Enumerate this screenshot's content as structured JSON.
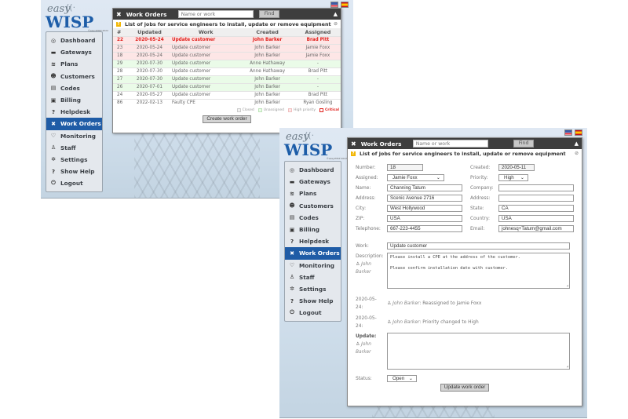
{
  "app": {
    "logo_top": "easy",
    "logo_main": "WISP",
    "logo_copyright": "©easyWISP 2022",
    "flags": [
      "English",
      "Español"
    ]
  },
  "sidebar": {
    "items": [
      {
        "label": "Dashboard",
        "icon": "dashboard-icon",
        "glyph": "◎"
      },
      {
        "label": "Gateways",
        "icon": "gateway-icon",
        "glyph": "▬"
      },
      {
        "label": "Plans",
        "icon": "plans-icon",
        "glyph": "≋"
      },
      {
        "label": "Customers",
        "icon": "customers-icon",
        "glyph": "☻"
      },
      {
        "label": "Codes",
        "icon": "codes-icon",
        "glyph": "▤"
      },
      {
        "label": "Billing",
        "icon": "billing-icon",
        "glyph": "▣"
      },
      {
        "label": "Helpdesk",
        "icon": "helpdesk-icon",
        "glyph": "?"
      },
      {
        "label": "Work Orders",
        "icon": "tools-icon",
        "glyph": "✖",
        "active": true
      },
      {
        "label": "Monitoring",
        "icon": "heartbeat-icon",
        "glyph": "♡"
      },
      {
        "label": "Staff",
        "icon": "user-icon",
        "glyph": "♙"
      },
      {
        "label": "Settings",
        "icon": "gear-icon",
        "glyph": "✲"
      },
      {
        "label": "Show Help",
        "icon": "help-icon",
        "glyph": "?"
      },
      {
        "label": "Logout",
        "icon": "power-icon",
        "glyph": "⏻"
      }
    ]
  },
  "panel": {
    "title": "Work Orders",
    "search_placeholder": "Name or work",
    "find_label": "Find",
    "info": "List of jobs for service engineers to install, update or remove equipment"
  },
  "list": {
    "columns": [
      "#",
      "Updated",
      "Work",
      "Created",
      "Assigned"
    ],
    "rows": [
      {
        "num": "22",
        "updated": "2020-05-24",
        "work": "Update customer",
        "created": "John Barker",
        "assigned": "Brad Pitt",
        "type": "crit"
      },
      {
        "num": "23",
        "updated": "2020-05-24",
        "work": "Update customer",
        "created": "John Barker",
        "assigned": "Jamie Foxx",
        "type": "pink"
      },
      {
        "num": "18",
        "updated": "2020-05-24",
        "work": "Update customer",
        "created": "John Barker",
        "assigned": "Jamie Foxx",
        "type": "pink"
      },
      {
        "num": "29",
        "updated": "2020-07-30",
        "work": "Update customer",
        "created": "Anne Hathaway",
        "assigned": "-",
        "type": "green"
      },
      {
        "num": "28",
        "updated": "2020-07-30",
        "work": "Update customer",
        "created": "Anne Hathaway",
        "assigned": "Brad Pitt",
        "type": "white"
      },
      {
        "num": "27",
        "updated": "2020-07-30",
        "work": "Update customer",
        "created": "John Barker",
        "assigned": "-",
        "type": "green"
      },
      {
        "num": "26",
        "updated": "2020-07-01",
        "work": "Update customer",
        "created": "John Barker",
        "assigned": "-",
        "type": "green"
      },
      {
        "num": "24",
        "updated": "2020-05-27",
        "work": "Update customer",
        "created": "John Barker",
        "assigned": "Brad Pitt",
        "type": "white"
      },
      {
        "num": "86",
        "updated": "2022-02-13",
        "work": "Faulty CPE",
        "created": "John Barker",
        "assigned": "Ryan Gosling",
        "type": "white"
      }
    ],
    "legend": [
      "Closed",
      "Unassigned",
      "High priority",
      "Critical"
    ],
    "create_label": "Create work order"
  },
  "form": {
    "labels": {
      "number": "Number:",
      "created": "Created:",
      "assigned": "Assigned:",
      "priority": "Priority:",
      "name": "Name:",
      "company": "Company:",
      "address": "Address:",
      "address2": "Address:",
      "city": "City:",
      "state": "State:",
      "zip": "ZIP:",
      "country": "Country:",
      "telephone": "Telephone:",
      "email": "Email:",
      "work": "Work:",
      "description": "Description:",
      "update": "Update:",
      "status": "Status:"
    },
    "values": {
      "number": "18",
      "created": "2020-05-11",
      "assigned": "Jamie Foxx",
      "priority": "High",
      "name": "Channing Tatum",
      "company": "",
      "address": "Scenic Avenue 2716",
      "address2": "",
      "city": "West Hollywood",
      "state": "CA",
      "zip": "USA",
      "country": "USA",
      "telephone": "667-223-4455",
      "email": "johnesq+Tatum@gmail.com",
      "work": "Update customer",
      "description_line1": "Please install a CPE at the address of the customer.",
      "description_line2": "Please confirm installation date with customer.",
      "update": "",
      "status": "Open"
    },
    "description_author_first": "John",
    "description_author_last": "Barker",
    "history": [
      {
        "date_a": "2020-05-",
        "date_b": "24:",
        "author": "John Barker",
        "text": ": Reassigned to Jamie Foxx"
      },
      {
        "date_a": "2020-05-",
        "date_b": "24:",
        "author": "John Barker",
        "text": ": Priority changed to High"
      }
    ],
    "update_author_first": "John",
    "update_author_last": "Barker",
    "submit_label": "Update work order"
  }
}
